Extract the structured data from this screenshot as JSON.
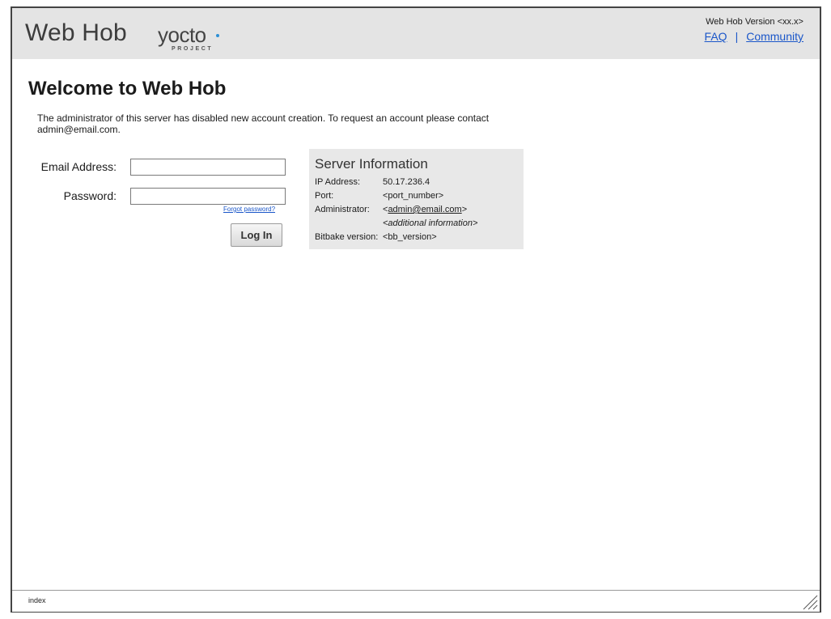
{
  "header": {
    "app_title": "Web Hob",
    "logo_word": "yocto",
    "logo_sub": "PROJECT",
    "version": "Web Hob Version <xx.x>",
    "links": {
      "faq": "FAQ",
      "separator": "|",
      "community": "Community"
    }
  },
  "main": {
    "title": "Welcome to Web Hob",
    "notice": "The administrator of this server has disabled new account creation. To request an account please contact admin@email.com."
  },
  "login": {
    "email_label": "Email Address:",
    "email_value": "",
    "password_label": "Password:",
    "password_value": "",
    "forgot_link": "Forgot password?",
    "login_button": "Log In"
  },
  "server_info": {
    "title": "Server Information",
    "ip_label": "IP Address:",
    "ip_value": "50.17.236.4",
    "port_label": "Port:",
    "port_value": "<port_number>",
    "admin_label": "Administrator:",
    "admin_prefix": "<",
    "admin_email": "admin@email.com",
    "admin_suffix": ">",
    "additional_info": "<additional information>",
    "bitbake_label": "Bitbake version:",
    "bitbake_value": "<bb_version>"
  },
  "footer": {
    "label": "index"
  },
  "colors": {
    "header_bg": "#e4e4e4",
    "link": "#1a56c9",
    "panel_bg": "#e8e8e8",
    "logo_dot": "#2d8fd5"
  },
  "icons": {
    "resize": "resize-grip-icon"
  }
}
